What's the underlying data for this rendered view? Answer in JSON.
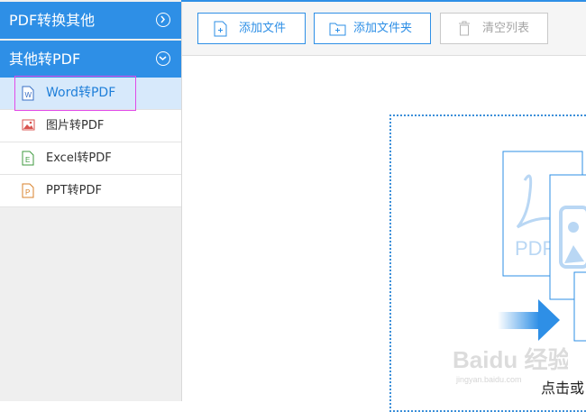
{
  "sidebar": {
    "group1": {
      "label": "PDF转换其他",
      "icon": "chevron-right-circle-icon"
    },
    "group2": {
      "label": "其他转PDF",
      "icon": "chevron-down-circle-icon"
    },
    "items": [
      {
        "label": "Word转PDF",
        "icon": "word-file-icon",
        "badge": "W"
      },
      {
        "label": "图片转PDF",
        "icon": "image-file-icon"
      },
      {
        "label": "Excel转PDF",
        "icon": "excel-file-icon",
        "badge": "E"
      },
      {
        "label": "PPT转PDF",
        "icon": "ppt-file-icon",
        "badge": "P"
      }
    ]
  },
  "toolbar": {
    "add_file_label": "添加文件",
    "add_folder_label": "添加文件夹",
    "clear_list_label": "清空列表"
  },
  "drop_zone": {
    "pdf_text": "PDF",
    "hint": "点击或"
  },
  "watermark": {
    "logo": "Baidu 经验",
    "url": "jingyan.baidu.com"
  },
  "colors": {
    "accent": "#2e8fe6",
    "active_bg": "#d7e9fb",
    "highlight": "#e14be8",
    "word": "#3a6fc4",
    "image": "#d9534f",
    "excel": "#3f9a3f",
    "ppt": "#d9822b"
  }
}
